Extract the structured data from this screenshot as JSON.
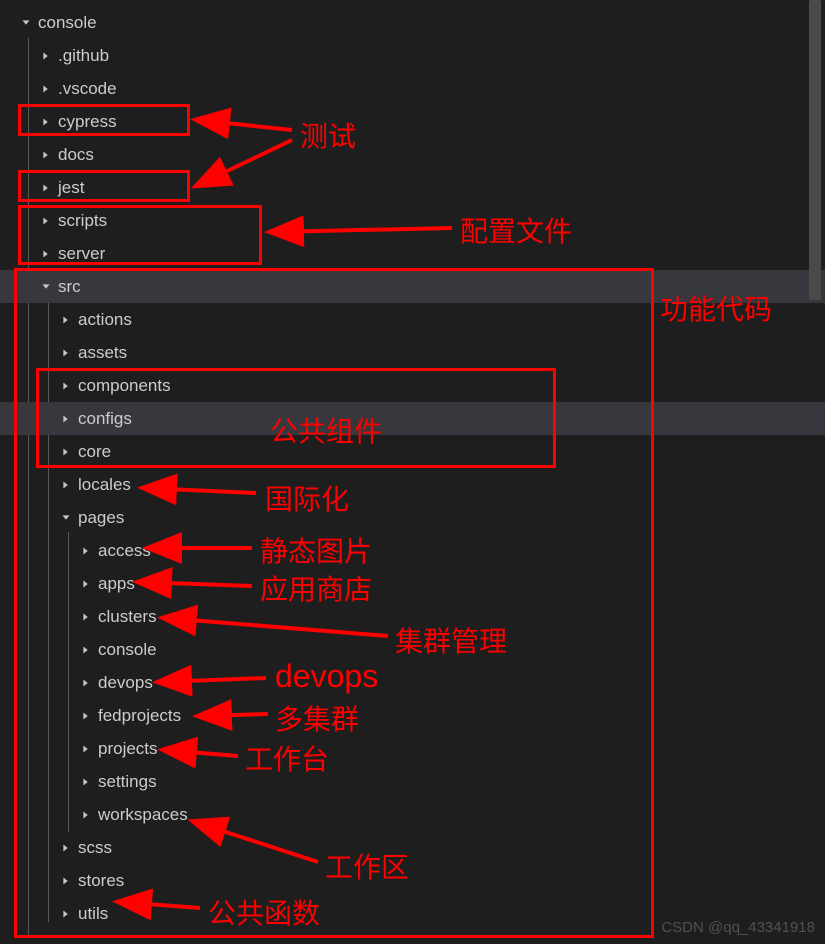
{
  "tree": {
    "root": {
      "label": "console",
      "expanded": true
    },
    "level1": [
      {
        "id": "github",
        "label": ".github",
        "expanded": false
      },
      {
        "id": "vscode",
        "label": ".vscode",
        "expanded": false
      },
      {
        "id": "cypress",
        "label": "cypress",
        "expanded": false
      },
      {
        "id": "docs",
        "label": "docs",
        "expanded": false
      },
      {
        "id": "jest",
        "label": "jest",
        "expanded": false
      },
      {
        "id": "scripts",
        "label": "scripts",
        "expanded": false
      },
      {
        "id": "server",
        "label": "server",
        "expanded": false
      },
      {
        "id": "src",
        "label": "src",
        "expanded": true,
        "selected": true
      }
    ],
    "src_children": [
      {
        "id": "actions",
        "label": "actions",
        "expanded": false
      },
      {
        "id": "assets",
        "label": "assets",
        "expanded": false
      },
      {
        "id": "components",
        "label": "components",
        "expanded": false
      },
      {
        "id": "configs",
        "label": "configs",
        "expanded": false,
        "selected": true
      },
      {
        "id": "core",
        "label": "core",
        "expanded": false
      },
      {
        "id": "locales",
        "label": "locales",
        "expanded": false
      },
      {
        "id": "pages",
        "label": "pages",
        "expanded": true
      },
      {
        "id": "scss",
        "label": "scss",
        "expanded": false
      },
      {
        "id": "stores",
        "label": "stores",
        "expanded": false
      },
      {
        "id": "utils",
        "label": "utils",
        "expanded": false
      }
    ],
    "pages_children": [
      {
        "id": "access",
        "label": "access"
      },
      {
        "id": "apps",
        "label": "apps"
      },
      {
        "id": "clusters",
        "label": "clusters"
      },
      {
        "id": "console",
        "label": "console"
      },
      {
        "id": "devops",
        "label": "devops"
      },
      {
        "id": "fedprojects",
        "label": "fedprojects"
      },
      {
        "id": "projects",
        "label": "projects"
      },
      {
        "id": "settings",
        "label": "settings"
      },
      {
        "id": "workspaces",
        "label": "workspaces"
      }
    ]
  },
  "annotations": {
    "test": "测试",
    "config": "配置文件",
    "feature": "功能代码",
    "common_comp": "公共组件",
    "i18n": "国际化",
    "static_img": "静态图片",
    "app_store": "应用商店",
    "cluster_mgmt": "集群管理",
    "devops": "devops",
    "multi_cluster": "多集群",
    "workbench": "工作台",
    "workspace": "工作区",
    "common_fn": "公共函数"
  },
  "watermark": "CSDN @qq_43341918"
}
